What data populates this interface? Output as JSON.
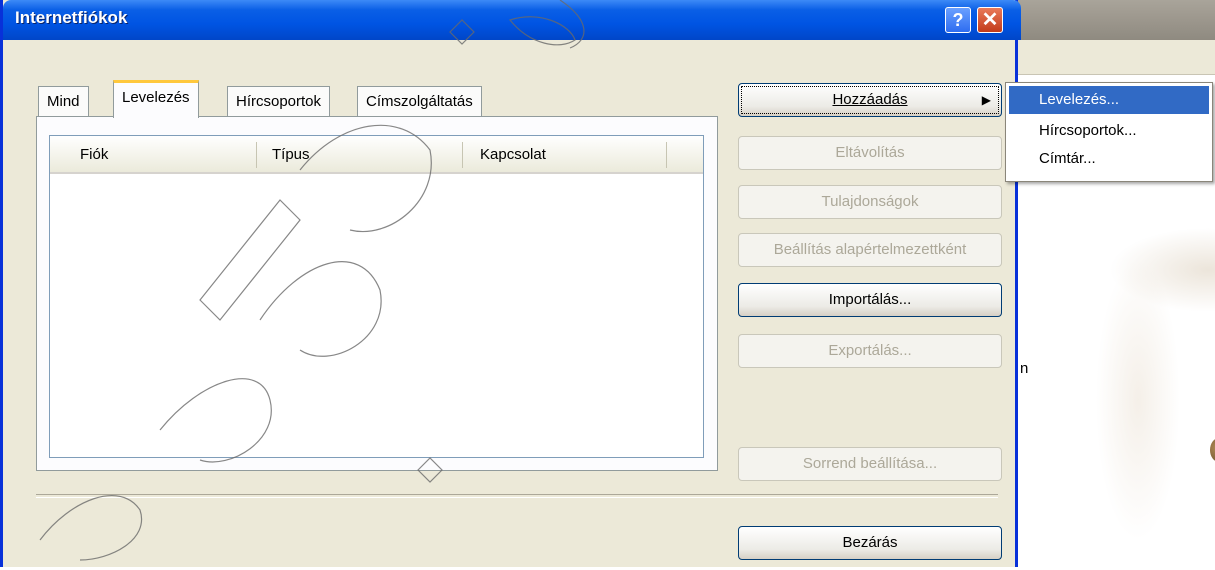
{
  "dialog": {
    "title": "Internetfiókok",
    "help_glyph": "?",
    "close_glyph": "✕"
  },
  "tabs": [
    {
      "label": "Mind"
    },
    {
      "label": "Levelezés"
    },
    {
      "label": "Hírcsoportok"
    },
    {
      "label": "Címszolgáltatás"
    }
  ],
  "list": {
    "columns": [
      "Fiók",
      "Típus",
      "Kapcsolat"
    ]
  },
  "buttons": {
    "add": "Hozzáadás",
    "remove": "Eltávolítás",
    "properties": "Tulajdonságok",
    "set_default": "Beállítás alapértelmezettként",
    "import": "Importálás...",
    "export": "Exportálás...",
    "set_order": "Sorrend beállítása...",
    "close": "Bezárás"
  },
  "menu": {
    "items": [
      "Levelezés...",
      "Hírcsoportok...",
      "Címtár..."
    ]
  },
  "background_window": {
    "visible_text": "n"
  },
  "colors": {
    "titlebar": "#0054e3",
    "selection": "#316ac5",
    "dialog_face": "#ece9d8",
    "tab_highlight": "#ffc83c"
  }
}
